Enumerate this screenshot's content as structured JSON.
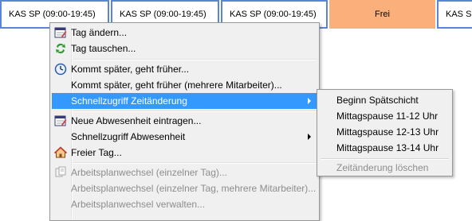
{
  "schedule": {
    "cells": [
      {
        "label": "KAS SP (09:00-19:45)"
      },
      {
        "label": "KAS SP (09:00-19:45)"
      },
      {
        "label": "KAS SP (09:00-19:45)"
      },
      {
        "label": "Frei",
        "color": "#fbb07c"
      },
      {
        "label": "KAS SP"
      }
    ],
    "border_color": "#5a84d6"
  },
  "context_menu": {
    "items": [
      {
        "label": "Tag ändern...",
        "icon": "calendar-edit-icon",
        "enabled": true
      },
      {
        "label": "Tag tauschen...",
        "icon": "swap-arrows-icon",
        "enabled": true
      },
      {
        "label": "Kommt später, geht früher...",
        "icon": "clock-icon",
        "enabled": true
      },
      {
        "label": "Kommt später, geht früher (mehrere Mitarbeiter)...",
        "icon": "",
        "enabled": true
      },
      {
        "label": "Schnellzugriff Zeitänderung",
        "icon": "",
        "enabled": true,
        "submenu": true,
        "selected": true
      },
      {
        "label": "Neue Abwesenheit eintragen...",
        "icon": "calendar-edit-icon",
        "enabled": true
      },
      {
        "label": "Schnellzugriff Abwesenheit",
        "icon": "",
        "enabled": true,
        "submenu": true
      },
      {
        "label": "Freier Tag...",
        "icon": "house-icon",
        "enabled": true
      },
      {
        "label": "Arbeitsplanwechsel (einzelner Tag)...",
        "icon": "document-swap-icon",
        "enabled": false
      },
      {
        "label": "Arbeitsplanwechsel (einzelner Tag, mehrere Mitarbeiter)...",
        "icon": "",
        "enabled": false
      },
      {
        "label": "Arbeitsplanwechsel verwalten...",
        "icon": "",
        "enabled": false
      }
    ],
    "highlight_color": "#3399ff"
  },
  "submenu": {
    "items": [
      {
        "label": "Beginn Spätschicht",
        "enabled": true
      },
      {
        "label": "Mittagspause 11-12 Uhr",
        "enabled": true
      },
      {
        "label": "Mittagspause 12-13 Uhr",
        "enabled": true
      },
      {
        "label": "Mittagspause 13-14 Uhr",
        "enabled": true
      },
      {
        "label": "Zeitänderung löschen",
        "enabled": false
      }
    ]
  }
}
